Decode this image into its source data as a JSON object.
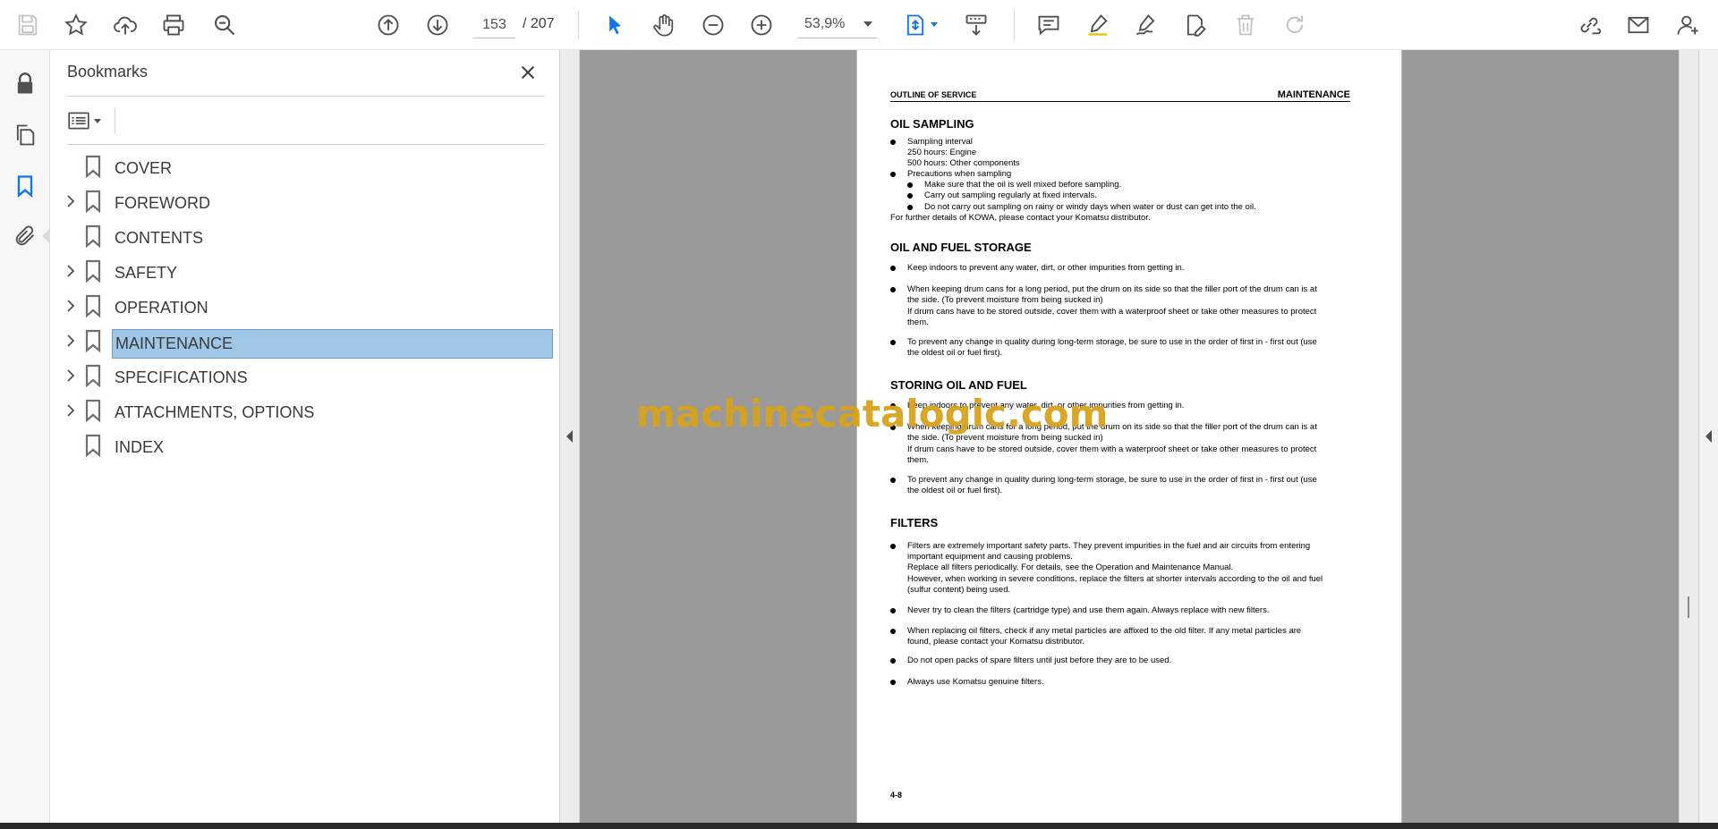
{
  "toolbar": {
    "current_page": "153",
    "page_total": "/ 207",
    "zoom": "53,9%",
    "icons": [
      "save-icon",
      "star-icon",
      "upload-cloud-icon",
      "print-icon",
      "search-zoom-icon",
      "page-up-icon",
      "page-down-icon",
      "select-cursor-icon",
      "hand-icon",
      "zoom-out-icon",
      "zoom-in-icon",
      "fit-page-icon",
      "scroll-mode-icon",
      "comment-icon",
      "highlight-icon",
      "sign-icon",
      "edit-icon",
      "delete-icon",
      "redo-icon",
      "share-link-icon",
      "email-icon",
      "account-icon"
    ]
  },
  "nav_rail": {
    "icons": [
      "lock-icon",
      "pages-icon",
      "bookmark-icon",
      "attachment-icon"
    ]
  },
  "bookmarks": {
    "title": "Bookmarks",
    "items": [
      {
        "label": "COVER",
        "expandable": false,
        "selected": false
      },
      {
        "label": "FOREWORD",
        "expandable": true,
        "selected": false
      },
      {
        "label": "CONTENTS",
        "expandable": false,
        "selected": false
      },
      {
        "label": "SAFETY",
        "expandable": true,
        "selected": false
      },
      {
        "label": "OPERATION",
        "expandable": true,
        "selected": false
      },
      {
        "label": "MAINTENANCE",
        "expandable": true,
        "selected": true
      },
      {
        "label": "SPECIFICATIONS",
        "expandable": true,
        "selected": false
      },
      {
        "label": "ATTACHMENTS, OPTIONS",
        "expandable": true,
        "selected": false
      },
      {
        "label": "INDEX",
        "expandable": false,
        "selected": false
      }
    ]
  },
  "page": {
    "header_left": "OUTLINE OF SERVICE",
    "header_right": "MAINTENANCE",
    "sec1_title": "OIL SAMPLING",
    "sec1": {
      "b1": "Sampling interval",
      "b1_l2": "250 hours: Engine",
      "b1_l3": "500 hours: Other components",
      "b2": "Precautions when sampling",
      "s1": "Make sure that the oil is well mixed before sampling.",
      "s2": "Carry out sampling regularly at fixed intervals.",
      "s3": "Do not carry out sampling on rainy or windy days when water or dust can get into the oil.",
      "note": "For further details of KOWA, please contact your Komatsu distributor."
    },
    "sec2_title": "OIL AND FUEL STORAGE",
    "sec2": {
      "b1": "Keep indoors to prevent any water, dirt, or other impurities from getting in.",
      "b2_l1": "When keeping drum cans for a long period, put the drum on its side so that the filler port of the drum can is at",
      "b2_l2": "the side. (To prevent moisture from being sucked in)",
      "b2_l3": "If drum cans have to be stored outside, cover them with a waterproof sheet or take other measures to protect",
      "b2_l4": "them.",
      "b3_l1": "To prevent any change in quality during long-term storage, be sure to use in the order of first in - first out (use",
      "b3_l2": "the oldest oil or fuel first)."
    },
    "sec3_title": "STORING OIL AND FUEL",
    "sec3": {
      "b1": "Keep indoors to prevent any water, dirt, or other impurities from getting in.",
      "b2_l1": "When keeping drum cans for a long period, put the drum on its side so that the filler port of the drum can is at",
      "b2_l2": "the side. (To prevent moisture from being sucked in)",
      "b2_l3": "If drum cans have to be stored outside, cover them with a waterproof sheet or take other measures to protect",
      "b2_l4": "them.",
      "b3_l1": "To prevent any change in quality during long-term storage, be sure to use in the order of first in - first out (use",
      "b3_l2": "the oldest oil or fuel first)."
    },
    "sec4_title": "FILTERS",
    "sec4": {
      "b1_l1": "Filters are extremely important safety parts. They prevent impurities in the fuel and air circuits from entering",
      "b1_l2": "important equipment and causing problems.",
      "b1_l3": "Replace all filters periodically. For details, see the Operation and Maintenance Manual.",
      "b1_l4": "However, when working in severe conditions, replace the filters at shorter intervals according to the oil and fuel",
      "b1_l5": "(sulfur content) being used.",
      "b2": "Never try to clean the filters (cartridge type) and use them again. Always replace with new filters.",
      "b3_l1": "When replacing oil filters, check if any metal particles are affixed to the old filter. If any metal particles are",
      "b3_l2": "found, please contact your Komatsu distributor.",
      "b4": "Do not open packs of spare filters until just before they are to be used.",
      "b5": "Always use Komatsu genuine filters."
    },
    "page_number": "4-8"
  },
  "watermark": "machinecatalogic.com",
  "colors": {
    "accent": "#1473e6",
    "selected_bookmark": "#9fc6e7",
    "document_bg": "#9a9a9a",
    "watermark": "#d8a31c"
  }
}
